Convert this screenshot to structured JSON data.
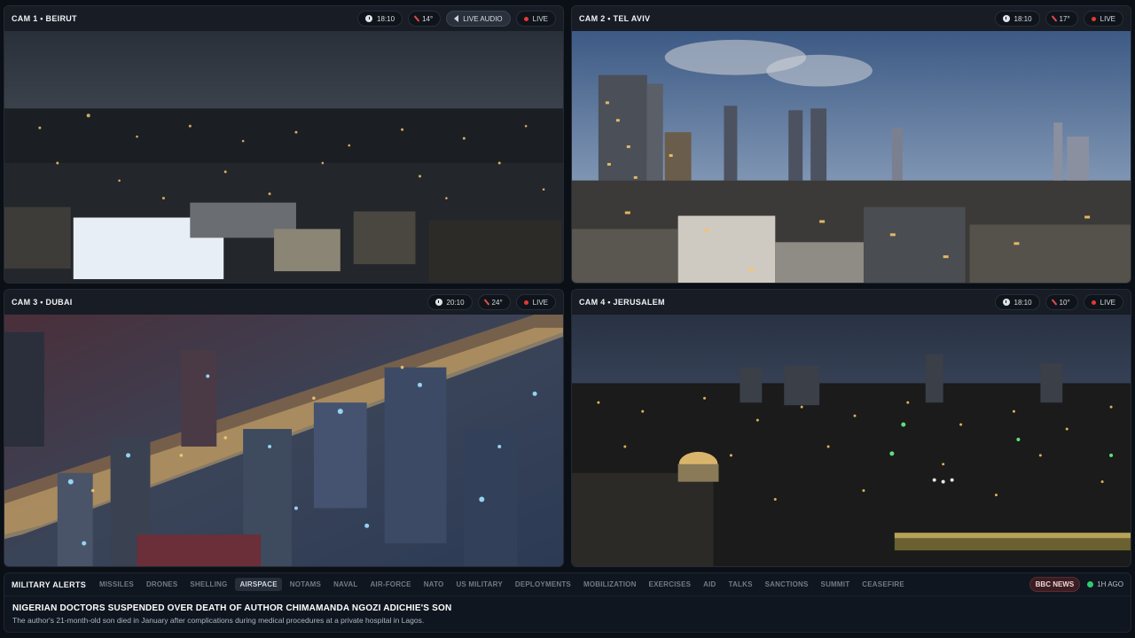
{
  "cameras": [
    {
      "title": "CAM 1 • BEIRUT",
      "time": "18:10",
      "temp": "14°",
      "audio_label": "LIVE AUDIO",
      "live": "LIVE"
    },
    {
      "title": "CAM 2 • TEL AVIV",
      "time": "18:10",
      "temp": "17°",
      "live": "LIVE"
    },
    {
      "title": "CAM 3 • DUBAI",
      "time": "20:10",
      "temp": "24°",
      "live": "LIVE"
    },
    {
      "title": "CAM 4 • JERUSALEM",
      "time": "18:10",
      "temp": "10°",
      "live": "LIVE"
    }
  ],
  "ticker": {
    "label": "MILITARY ALERTS",
    "categories": [
      "MISSILES",
      "DRONES",
      "SHELLING",
      "AIRSPACE",
      "NOTAMS",
      "NAVAL",
      "AIR-FORCE",
      "NATO",
      "US MILITARY",
      "DEPLOYMENTS",
      "MOBILIZATION",
      "EXERCISES",
      "AID",
      "TALKS",
      "SANCTIONS",
      "SUMMIT",
      "CEASEFIRE"
    ],
    "active_category": "AIRSPACE",
    "source": "BBC NEWS",
    "ago": "1H AGO",
    "headline": "NIGERIAN DOCTORS SUSPENDED OVER DEATH OF AUTHOR CHIMAMANDA NGOZI ADICHIE'S SON",
    "summary": "The author's 21-month-old son died in January after complications during medical procedures at a private hospital in Lagos."
  },
  "colors": {
    "live": "#e53935",
    "temp_icon": "#e04a4a",
    "fresh": "#2ecc71",
    "panel": "#151a22",
    "bg": "#0b0f16"
  },
  "icons": [
    "clock-icon",
    "thermometer-icon",
    "speaker-icon",
    "live-dot-icon",
    "status-dot-icon"
  ]
}
